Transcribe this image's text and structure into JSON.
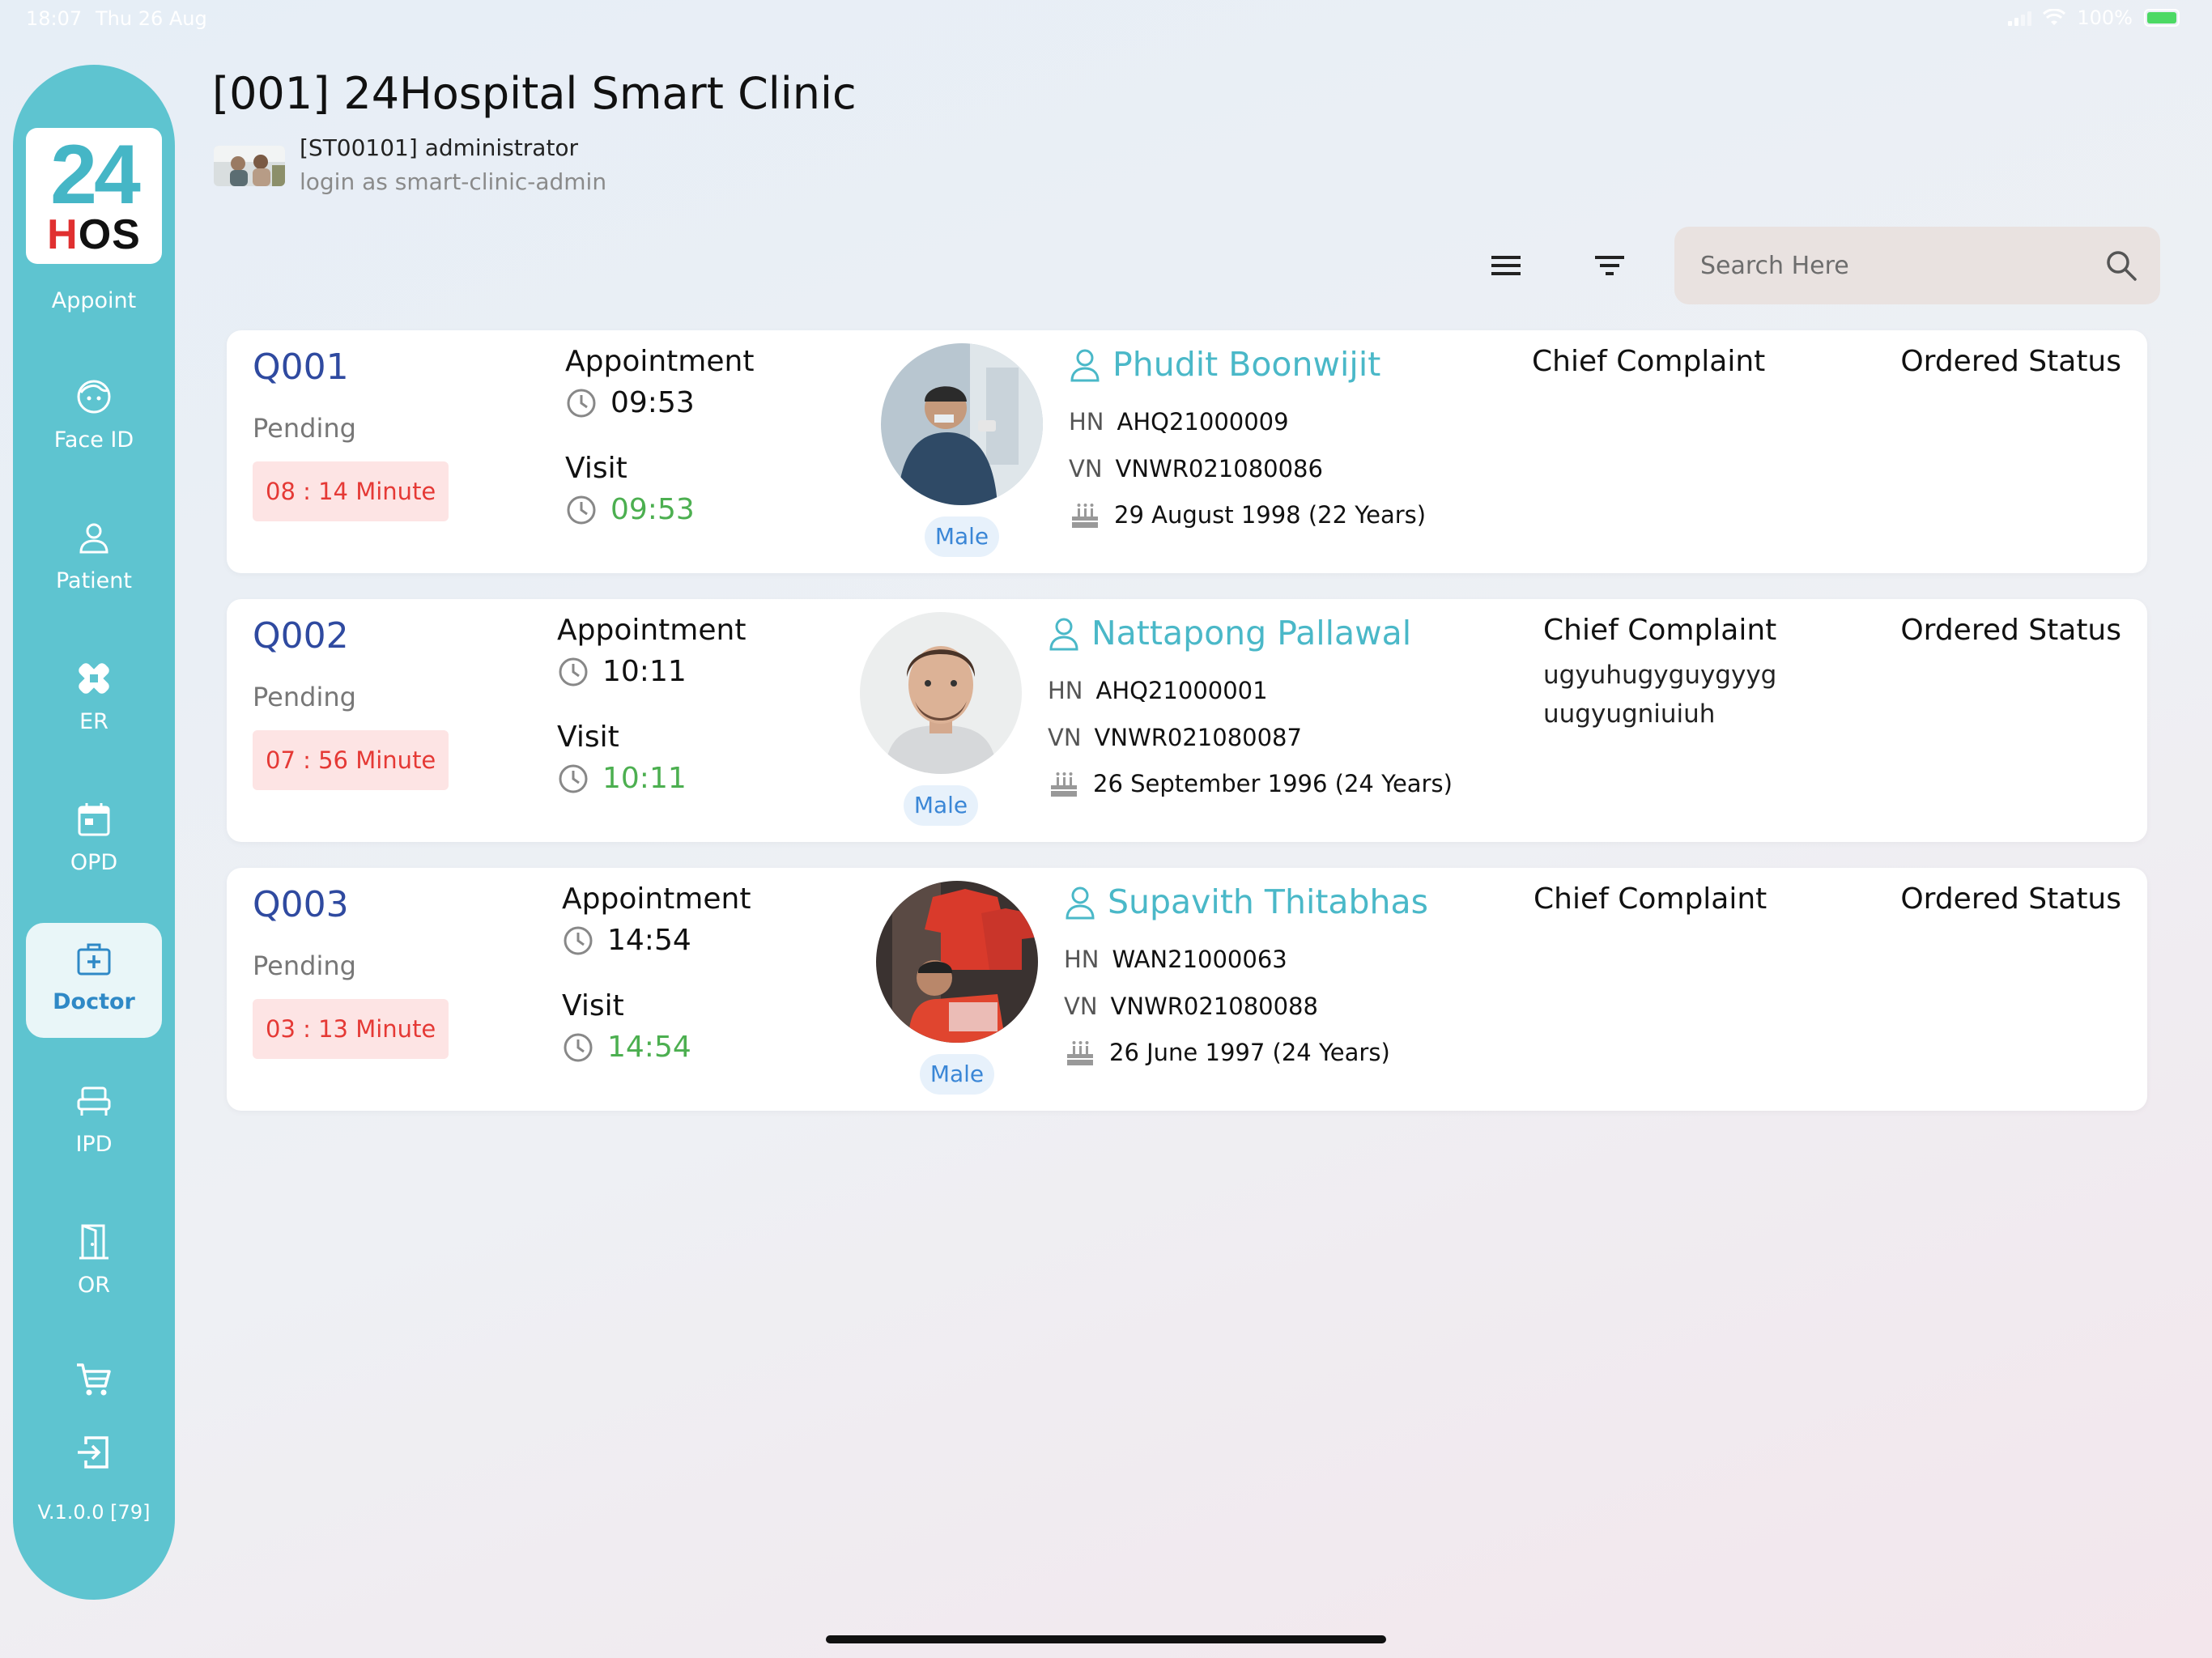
{
  "statusbar": {
    "time": "18:07",
    "date": "Thu 26 Aug",
    "battery": "100%"
  },
  "sidebar": {
    "logo_top": "24",
    "logo_bottom_cross": "H",
    "logo_bottom_rest": "OS",
    "top_label": "Appoint",
    "items": [
      {
        "label": "Face ID",
        "icon": "face-icon"
      },
      {
        "label": "Patient",
        "icon": "person-icon"
      },
      {
        "label": "ER",
        "icon": "bandage-icon"
      },
      {
        "label": "OPD",
        "icon": "calendar-icon"
      },
      {
        "label": "Doctor",
        "icon": "medical-kit-icon",
        "active": true
      },
      {
        "label": "IPD",
        "icon": "bed-icon"
      },
      {
        "label": "OR",
        "icon": "door-icon"
      }
    ],
    "version": "V.1.0.0 [79]"
  },
  "header": {
    "title": "[001] 24Hospital Smart Clinic",
    "user": "[ST00101] administrator",
    "login": "login as smart-clinic-admin"
  },
  "search": {
    "placeholder": "Search Here"
  },
  "labels": {
    "appointment": "Appointment",
    "visit": "Visit",
    "chief_complaint": "Chief Complaint",
    "ordered_status": "Ordered Status",
    "hn": "HN",
    "vn": "VN"
  },
  "queue": [
    {
      "no": "Q001",
      "status": "Pending",
      "wait": "08 : 14 Minute",
      "appointment": "09:53",
      "visit": "09:53",
      "name": "Phudit Boonwijit",
      "hn": "AHQ21000009",
      "vn": "VNWR021080086",
      "dob": "29 August 1998 (22 Years)",
      "gender": "Male",
      "complaint": ""
    },
    {
      "no": "Q002",
      "status": "Pending",
      "wait": "07 : 56 Minute",
      "appointment": "10:11",
      "visit": "10:11",
      "name": "Nattapong Pallawal",
      "hn": "AHQ21000001",
      "vn": "VNWR021080087",
      "dob": "26 September 1996 (24 Years)",
      "gender": "Male",
      "complaint": "ugyuhugyguygyyg uugyugniuiuh"
    },
    {
      "no": "Q003",
      "status": "Pending",
      "wait": "03 : 13 Minute",
      "appointment": "14:54",
      "visit": "14:54",
      "name": "Supavith Thitabhas",
      "hn": "WAN21000063",
      "vn": "VNWR021080088",
      "dob": "26 June 1997 (24 Years)",
      "gender": "Male",
      "complaint": ""
    }
  ],
  "colors": {
    "sidebar": "#5ec4d0",
    "queue_number": "#2f4aa0",
    "patient_name": "#4ab8c8",
    "wait_text": "#e53935",
    "visit_time": "#4caf50",
    "gender_badge": "#3a86d6"
  }
}
